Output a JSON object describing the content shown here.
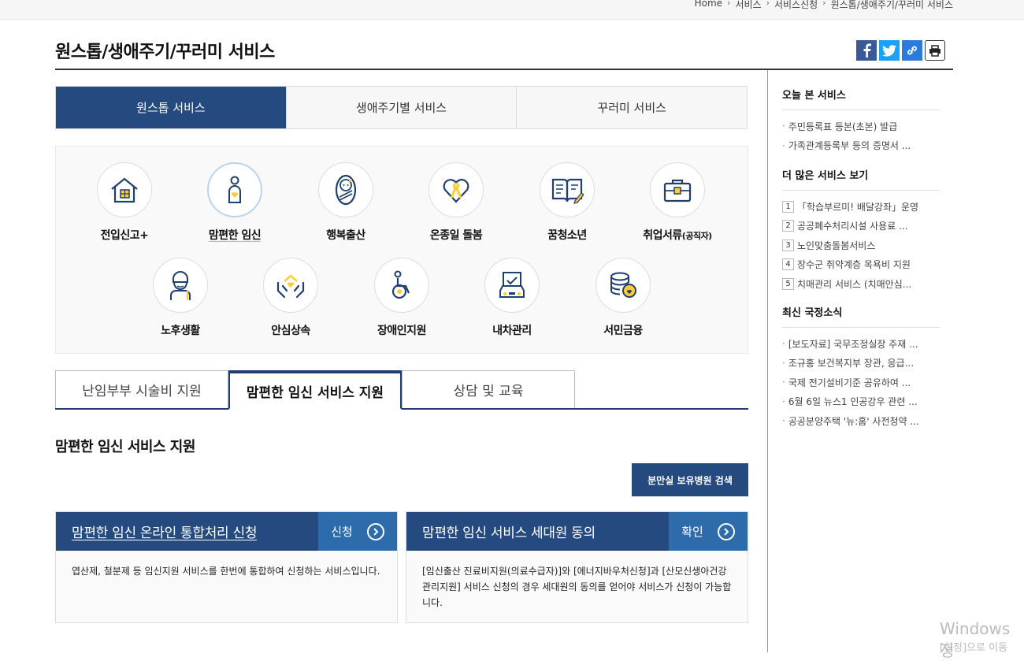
{
  "breadcrumb": [
    "Home",
    "서비스",
    "서비스신청",
    "원스톱/생애주기/꾸러미 서비스"
  ],
  "page_title": "원스톱/생애주기/꾸러미 서비스",
  "main_tabs": [
    "원스톱 서비스",
    "생애주기별 서비스",
    "꾸러미 서비스"
  ],
  "services": [
    {
      "label": "전입신고+",
      "icon": "house-icon"
    },
    {
      "label": "맘편한 임신",
      "icon": "pregnant-icon"
    },
    {
      "label": "행복출산",
      "icon": "baby-icon"
    },
    {
      "label": "온종일 돌봄",
      "icon": "ribbon-heart-icon"
    },
    {
      "label": "꿈청소년",
      "icon": "book-icon"
    },
    {
      "label": "취업서류",
      "label_small": "(공직자)",
      "icon": "briefcase-icon"
    },
    {
      "label": "노후생활",
      "icon": "elder-icon"
    },
    {
      "label": "안심상속",
      "icon": "hands-house-icon"
    },
    {
      "label": "장애인지원",
      "icon": "wheelchair-icon"
    },
    {
      "label": "내차관리",
      "icon": "car-icon"
    },
    {
      "label": "서민금융",
      "icon": "coins-icon"
    }
  ],
  "sub_tabs": [
    "난임부부 시술비 지원",
    "맘편한 임신 서비스 지원",
    "상담 및 교육"
  ],
  "section_title": "맘편한 임신 서비스 지원",
  "hospital_button": "분만실 보유병원 검색",
  "cards": [
    {
      "title": "맘편한 임신 온라인 통합처리 신청",
      "action": "신청",
      "desc": "엽산제, 철분제 등 임신지원 서비스를 한번에 통합하여 신청하는 서비스입니다."
    },
    {
      "title": "맘편한 임신 서비스 세대원 동의",
      "action": "확인",
      "desc": "[임신출산 진료비지원(의료수급자)]와 [에너지바우처신청]과 [산모신생아건강관리지원] 서비스 신청의 경우 세대원의 동의를 얻어야 서비스가 신청이 가능합니다."
    }
  ],
  "sidebar": {
    "today": {
      "title": "오늘 본 서비스",
      "items": [
        "주민등록표 등본(초본) 발급",
        "가족관계등록부 등의 증명서 ..."
      ]
    },
    "more": {
      "title": "더 많은 서비스 보기",
      "items": [
        "「학습부르미! 배달강좌」운영",
        "공공폐수처리시설 사용료 ...",
        "노인맞춤돌봄서비스",
        "장수군 취약계층 목욕비 지원",
        "치매관리 서비스 (치매안심..."
      ]
    },
    "news": {
      "title": "최신 국정소식",
      "items": [
        "[보도자료] 국무조정실장 주재 ...",
        "조규홍 보건복지부 장관, 응급...",
        "국제 전기설비기준 공유하여 ...",
        "6월 6일 뉴스1 인공강우 관련 ...",
        "공공분양주택 '뉴:홈' 사전청약 ..."
      ]
    }
  },
  "watermark": {
    "line1": "Windows 정",
    "line2": "[설정]으로 이동"
  },
  "colors": {
    "primary": "#244a80",
    "accent": "#2d6bab"
  }
}
